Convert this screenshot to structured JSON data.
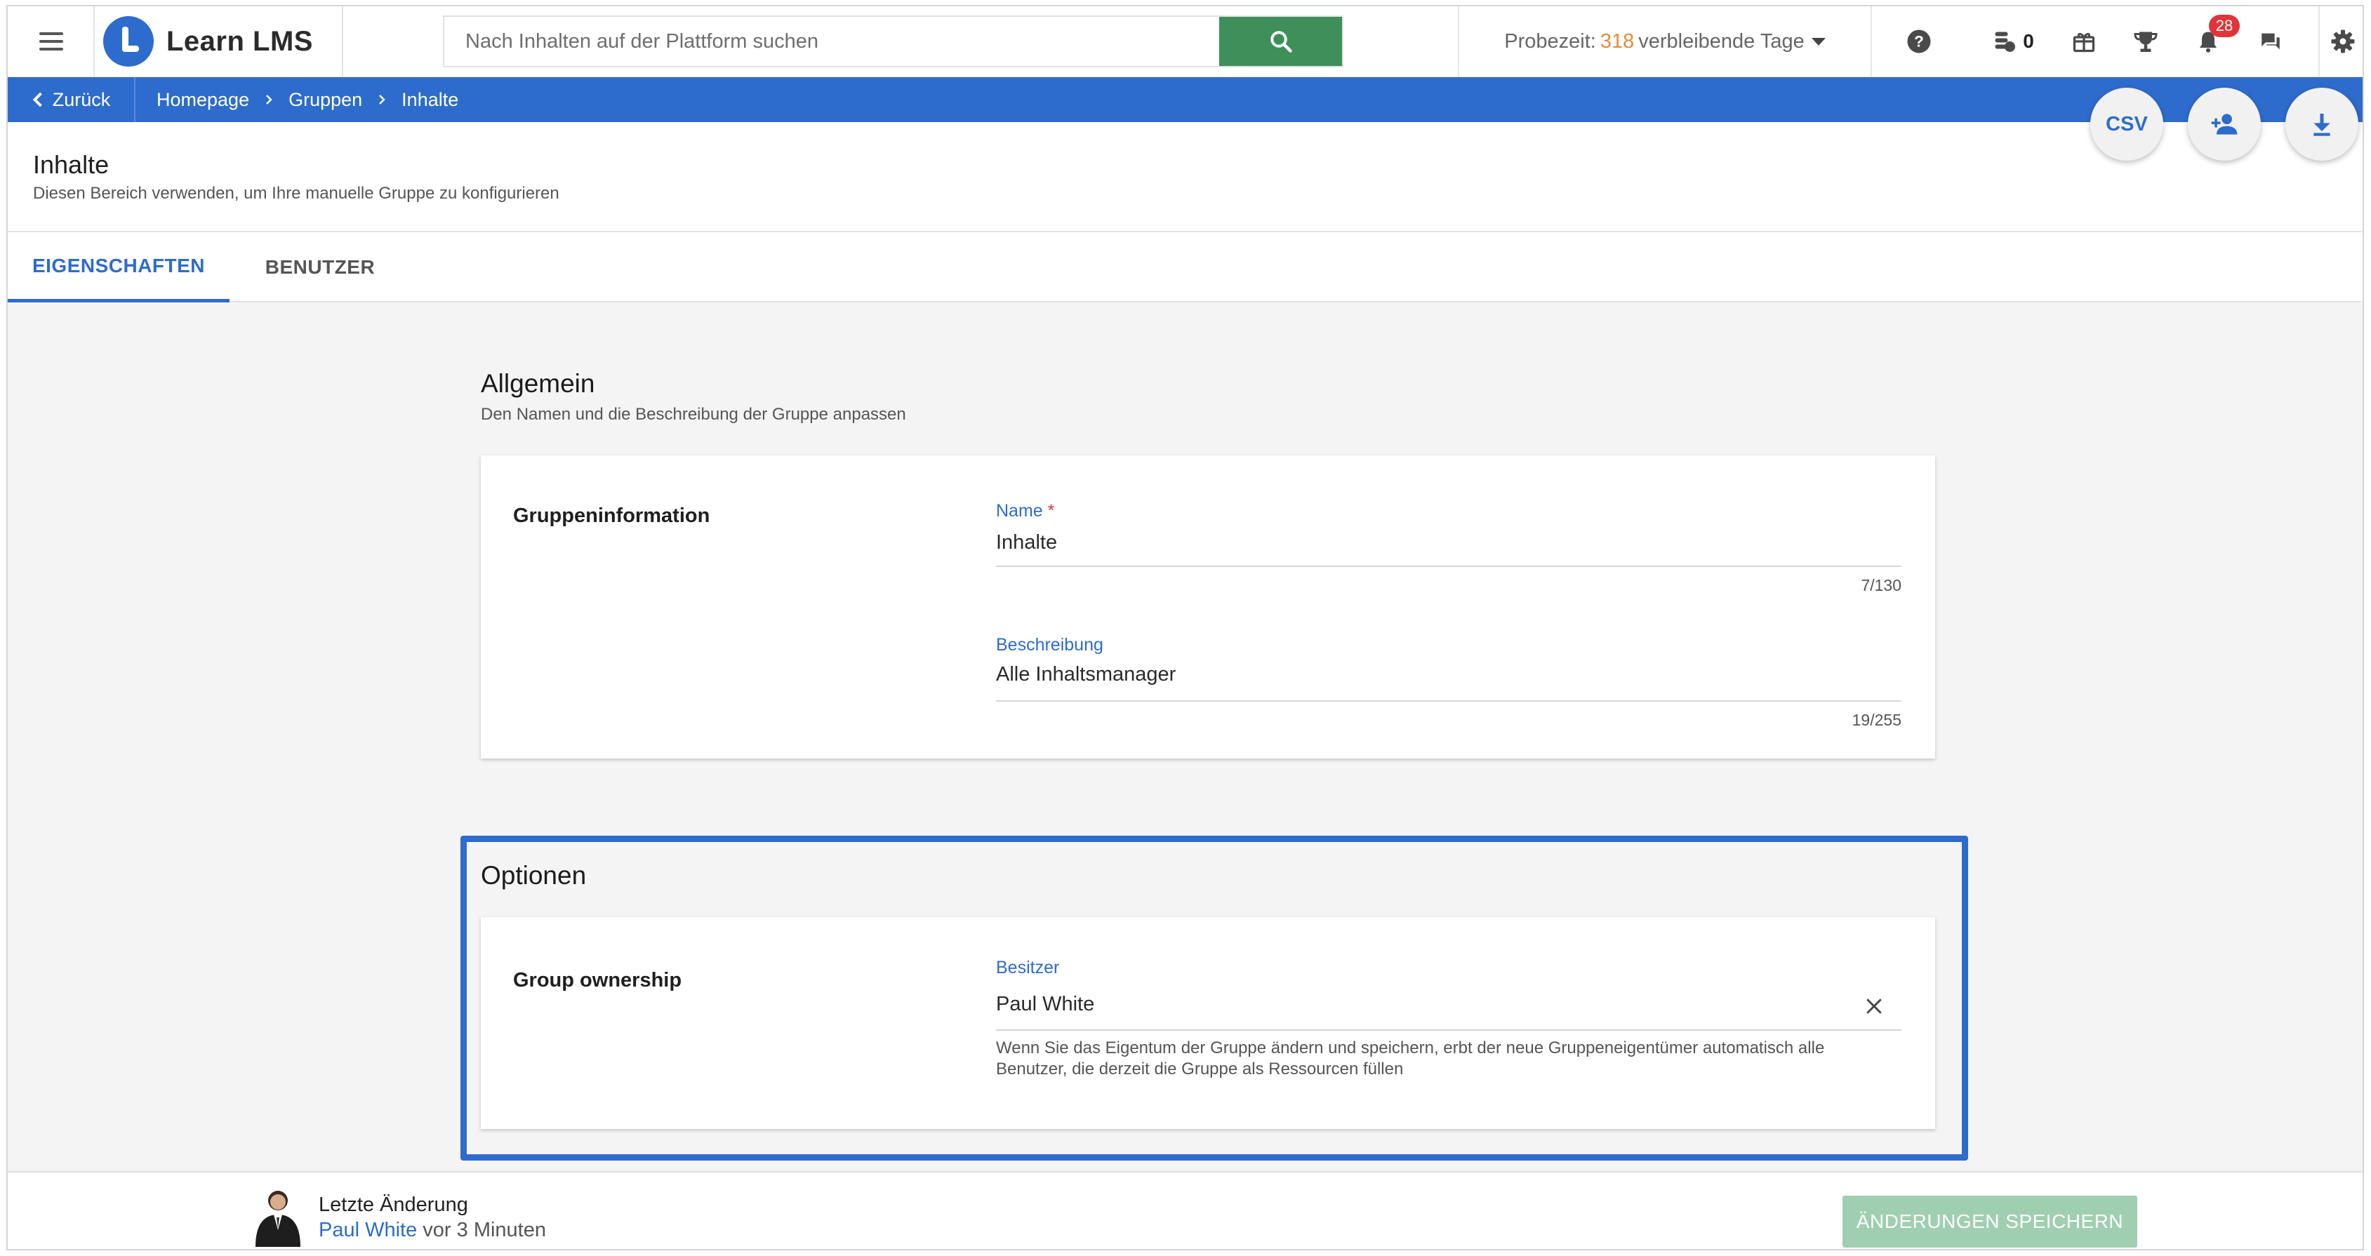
{
  "app": {
    "name": "Learn LMS"
  },
  "search": {
    "placeholder": "Nach Inhalten auf der Plattform suchen"
  },
  "trial": {
    "prefix": "Probezeit:",
    "days": "318",
    "suffix": "verbleibende Tage"
  },
  "header_icons": {
    "help": "help-icon",
    "coins": {
      "icon": "coins-icon",
      "count": "0"
    },
    "gift": "gift-icon",
    "trophy": "trophy-icon",
    "notifications": {
      "icon": "bell-icon",
      "count": "28"
    },
    "messages": "chat-icon",
    "settings": "gear-icon"
  },
  "breadcrumb": {
    "back_label": "Zurück",
    "items": [
      "Homepage",
      "Gruppen",
      "Inhalte"
    ]
  },
  "actions": {
    "csv_label": "CSV",
    "add_user": "add-user-icon",
    "download": "download-icon"
  },
  "page": {
    "title": "Inhalte",
    "subtitle": "Diesen Bereich verwenden, um Ihre manuelle Gruppe zu konfigurieren"
  },
  "tabs": [
    {
      "label": "EIGENSCHAFTEN",
      "active": true
    },
    {
      "label": "BENUTZER",
      "active": false
    }
  ],
  "general": {
    "title": "Allgemein",
    "subtitle": "Den Namen und die Beschreibung der Gruppe anpassen",
    "card_label": "Gruppeninformation",
    "name": {
      "label": "Name",
      "required_mark": "*",
      "value": "Inhalte",
      "counter": "7/130"
    },
    "description": {
      "label": "Beschreibung",
      "value": "Alle Inhaltsmanager",
      "counter": "19/255"
    }
  },
  "options": {
    "title": "Optionen",
    "card_label": "Group ownership",
    "owner": {
      "label": "Besitzer",
      "value": "Paul White",
      "help_line1": "Wenn Sie das Eigentum der Gruppe ändern und speichern, erbt der neue Gruppeneigentümer automatisch alle",
      "help_line2": "Benutzer, die derzeit die Gruppe als Ressourcen füllen"
    }
  },
  "footer": {
    "title": "Letzte Änderung",
    "user": "Paul White",
    "time": "vor 3 Minuten",
    "save_label": "ÄNDERUNGEN SPEICHERN"
  },
  "colors": {
    "accent": "#2d6ccc",
    "search_button": "#3e8f5a",
    "trial_days": "#e98a3c",
    "badge": "#e0343a",
    "save_button_disabled": "#9fcfb0"
  }
}
